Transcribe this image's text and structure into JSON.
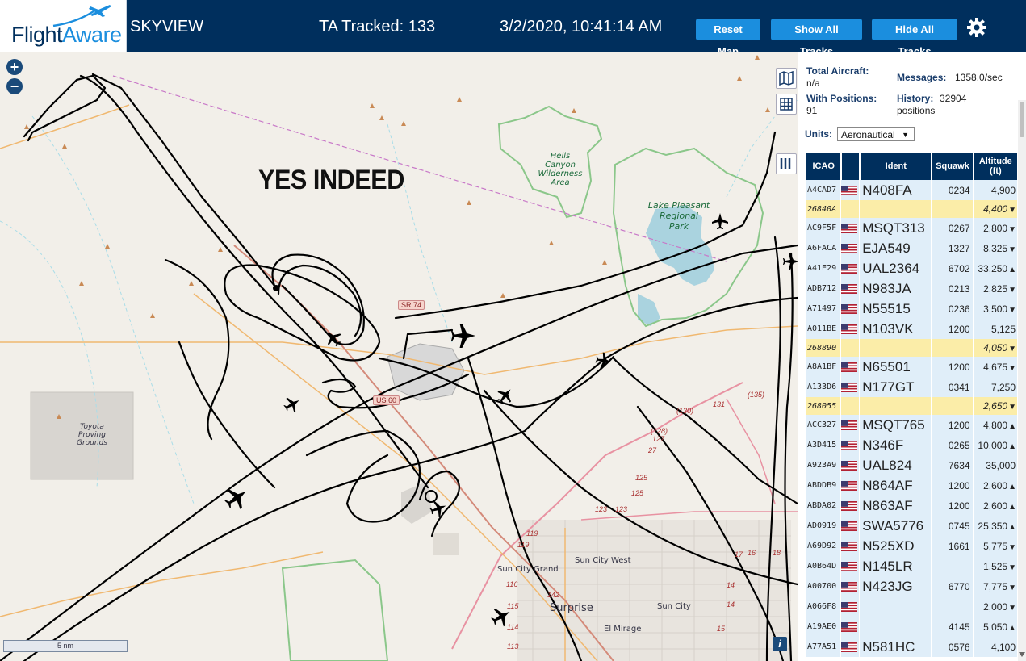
{
  "header": {
    "logo_flight": "Flight",
    "logo_aware": "Aware",
    "app_title": "SKYVIEW",
    "ta_tracked": "TA Tracked: 133",
    "clock": "3/2/2020, 10:41:14 AM",
    "reset_map": "Reset Map",
    "show_all": "Show All Tracks",
    "hide_all": "Hide All Tracks",
    "settings_icon": "gear-icon"
  },
  "map": {
    "zoom_in": "+",
    "zoom_out": "−",
    "annotation": "YES INDEED",
    "scale": "5 nm",
    "info": "i",
    "labels": {
      "hells_canyon": "Hells Canyon\nWilderness\nArea",
      "lake_pleasant": "Lake Pleasant\nRegional\nPark",
      "toyota": "Toyota\nProving\nGrounds",
      "sun_city_west": "Sun City West",
      "sun_city_grand": "Sun City Grand",
      "surprise": "Surprise",
      "sun_city": "Sun City",
      "el_mirage": "El Mirage",
      "us60": "US 60",
      "sr74": "SR 74"
    },
    "route_numbers": [
      "(135)",
      "131",
      "(130)",
      "(128)",
      "127",
      "27",
      "125",
      "125",
      "123",
      "123",
      "119",
      "119",
      "142",
      "116",
      "115",
      "114",
      "113",
      "17",
      "16",
      "18",
      "14",
      "14",
      "15"
    ],
    "colors": {
      "land": "#f2efe9",
      "water": "#aad3df",
      "park_outline": "#8bc78a",
      "track": "#000000",
      "road": "#f0b870",
      "highway": "#e892a2"
    }
  },
  "sidebar": {
    "total_aircraft_label": "Total Aircraft:",
    "total_aircraft_value": "n/a",
    "with_positions_label": "With Positions:",
    "with_positions_value": "91",
    "messages_label": "Messages:",
    "messages_value": "1358.0/sec",
    "history_label": "History:",
    "history_value": "32904",
    "history_unit": "positions",
    "units_label": "Units:",
    "units_selected": "Aeronautical",
    "columns": [
      "ICAO",
      "",
      "Ident",
      "Squawk",
      "Altitude (ft)"
    ],
    "rows": [
      {
        "icao": "A4CAD7",
        "flag": true,
        "ident": "N408FA",
        "squawk": "0234",
        "alt": "4,900",
        "trend": "",
        "hl": false
      },
      {
        "icao": "26840A",
        "flag": false,
        "ident": "",
        "squawk": "",
        "alt": "4,400",
        "trend": "▼",
        "hl": true
      },
      {
        "icao": "AC9F5F",
        "flag": true,
        "ident": "MSQT313",
        "squawk": "0267",
        "alt": "2,800",
        "trend": "▼",
        "hl": false
      },
      {
        "icao": "A6FACA",
        "flag": true,
        "ident": "EJA549",
        "squawk": "1327",
        "alt": "8,325",
        "trend": "▼",
        "hl": false
      },
      {
        "icao": "A41E29",
        "flag": true,
        "ident": "UAL2364",
        "squawk": "6702",
        "alt": "33,250",
        "trend": "▲",
        "hl": false
      },
      {
        "icao": "ADB712",
        "flag": true,
        "ident": "N983JA",
        "squawk": "0213",
        "alt": "2,825",
        "trend": "▼",
        "hl": false
      },
      {
        "icao": "A71497",
        "flag": true,
        "ident": "N55515",
        "squawk": "0236",
        "alt": "3,500",
        "trend": "▼",
        "hl": false
      },
      {
        "icao": "A011BE",
        "flag": true,
        "ident": "N103VK",
        "squawk": "1200",
        "alt": "5,125",
        "trend": "",
        "hl": false
      },
      {
        "icao": "268890",
        "flag": false,
        "ident": "",
        "squawk": "",
        "alt": "4,050",
        "trend": "▼",
        "hl": true
      },
      {
        "icao": "A8A1BF",
        "flag": true,
        "ident": "N65501",
        "squawk": "1200",
        "alt": "4,675",
        "trend": "▼",
        "hl": false
      },
      {
        "icao": "A133D6",
        "flag": true,
        "ident": "N177GT",
        "squawk": "0341",
        "alt": "7,250",
        "trend": "",
        "hl": false
      },
      {
        "icao": "268055",
        "flag": false,
        "ident": "",
        "squawk": "",
        "alt": "2,650",
        "trend": "▼",
        "hl": true
      },
      {
        "icao": "ACC327",
        "flag": true,
        "ident": "MSQT765",
        "squawk": "1200",
        "alt": "4,800",
        "trend": "▲",
        "hl": false
      },
      {
        "icao": "A3D415",
        "flag": true,
        "ident": "N346F",
        "squawk": "0265",
        "alt": "10,000",
        "trend": "▲",
        "hl": false
      },
      {
        "icao": "A923A9",
        "flag": true,
        "ident": "UAL824",
        "squawk": "7634",
        "alt": "35,000",
        "trend": "",
        "hl": false
      },
      {
        "icao": "ABDDB9",
        "flag": true,
        "ident": "N864AF",
        "squawk": "1200",
        "alt": "2,600",
        "trend": "▲",
        "hl": false
      },
      {
        "icao": "ABDA02",
        "flag": true,
        "ident": "N863AF",
        "squawk": "1200",
        "alt": "2,600",
        "trend": "▲",
        "hl": false
      },
      {
        "icao": "AD0919",
        "flag": true,
        "ident": "SWA5776",
        "squawk": "0745",
        "alt": "25,350",
        "trend": "▲",
        "hl": false
      },
      {
        "icao": "A69D92",
        "flag": true,
        "ident": "N525XD",
        "squawk": "1661",
        "alt": "5,775",
        "trend": "▼",
        "hl": false
      },
      {
        "icao": "A0B64D",
        "flag": true,
        "ident": "N145LR",
        "squawk": "",
        "alt": "1,525",
        "trend": "▼",
        "hl": false
      },
      {
        "icao": "A00700",
        "flag": true,
        "ident": "N423JG",
        "squawk": "6770",
        "alt": "7,775",
        "trend": "▼",
        "hl": false
      },
      {
        "icao": "A066F8",
        "flag": true,
        "ident": "",
        "squawk": "",
        "alt": "2,000",
        "trend": "▼",
        "hl": false
      },
      {
        "icao": "A19AE0",
        "flag": true,
        "ident": "",
        "squawk": "4145",
        "alt": "5,050",
        "trend": "▲",
        "hl": false
      },
      {
        "icao": "A77A51",
        "flag": true,
        "ident": "N581HC",
        "squawk": "0576",
        "alt": "4,100",
        "trend": "",
        "hl": false
      }
    ]
  }
}
